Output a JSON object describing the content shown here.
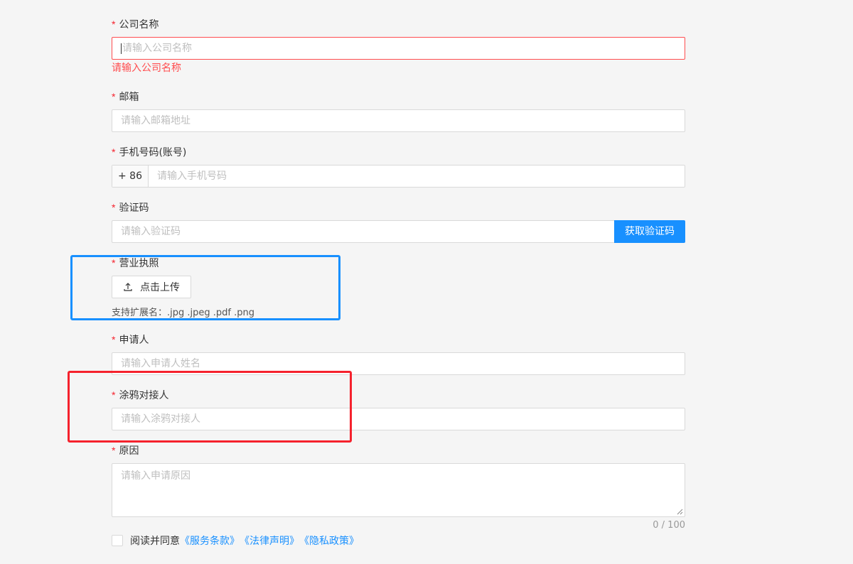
{
  "form": {
    "company": {
      "label": "公司名称",
      "placeholder": "请输入公司名称",
      "error": "请输入公司名称"
    },
    "email": {
      "label": "邮箱",
      "placeholder": "请输入邮箱地址"
    },
    "phone": {
      "label": "手机号码(账号)",
      "prefix": "+ 86",
      "placeholder": "请输入手机号码"
    },
    "code": {
      "label": "验证码",
      "placeholder": "请输入验证码",
      "button": "获取验证码"
    },
    "license": {
      "label": "营业执照",
      "button": "点击上传",
      "hint": "支持扩展名：.jpg .jpeg .pdf .png"
    },
    "applicant": {
      "label": "申请人",
      "placeholder": "请输入申请人姓名"
    },
    "contact": {
      "label": "涂鸦对接人",
      "placeholder": "请输入涂鸦对接人"
    },
    "reason": {
      "label": "原因",
      "placeholder": "请输入申请原因",
      "counter": "0 / 100"
    },
    "required_mark": "*"
  },
  "agreement": {
    "text": "阅读并同意",
    "links": [
      "《服务条款》",
      "《法律声明》",
      "《隐私政策》"
    ]
  },
  "colors": {
    "primary": "#1890ff",
    "error": "#ff4d4f",
    "highlight_blue": "#1890ff",
    "highlight_red": "#f5222d"
  },
  "icons": [
    "upload-icon"
  ]
}
